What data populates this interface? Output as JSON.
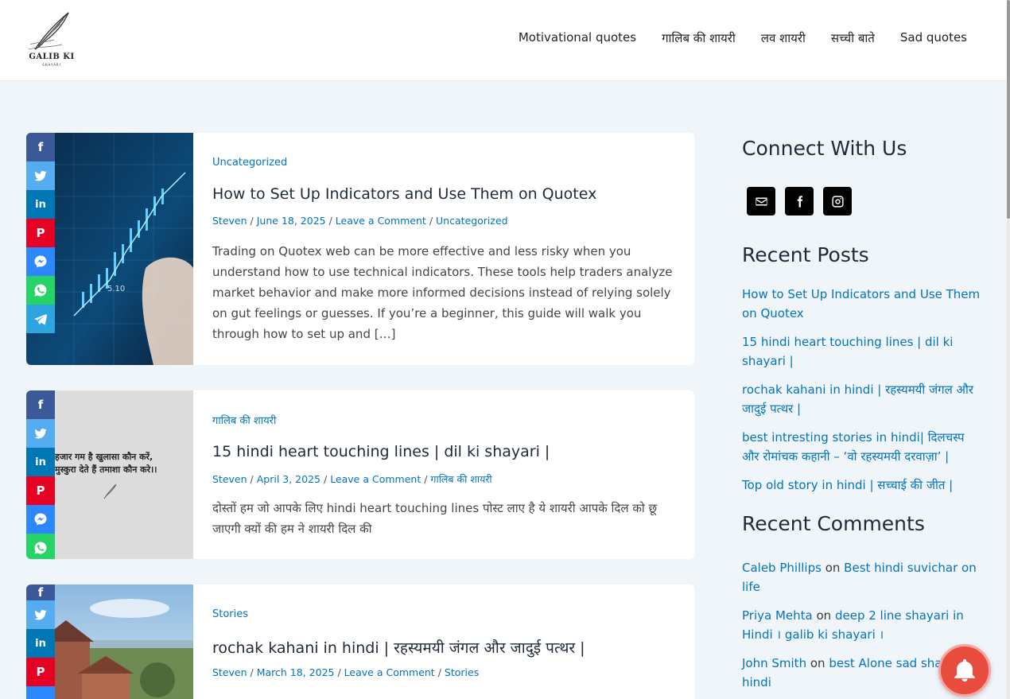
{
  "site": {
    "logo_text": "GALIB KI",
    "logo_sub": "SHAYARI"
  },
  "nav": [
    {
      "label": "Motivational quotes"
    },
    {
      "label": "गालिब की शायरी"
    },
    {
      "label": "लव शायरी"
    },
    {
      "label": "सच्ची बाते"
    },
    {
      "label": "Sad quotes"
    }
  ],
  "posts": [
    {
      "category": "Uncategorized",
      "title": "How to Set Up Indicators and Use Them on Quotex",
      "author": "Steven",
      "date": "June 18, 2025",
      "comment_link": "Leave a Comment",
      "meta_category": "Uncategorized",
      "excerpt": "Trading on Quotex web can be more effective and less risky when you understand how to use technical indicators. These tools help traders analyze market behavior and make more informed decisions instead of relying solely on gut feelings or guesses. If you’re a beginner, this guide will walk you through how to set up and […]",
      "thumb_text": "5.10"
    },
    {
      "category": "गालिब की शायरी",
      "title": "15 hindi heart touching lines | dil ki shayari |",
      "author": "Steven",
      "date": "April 3, 2025",
      "comment_link": "Leave a Comment",
      "meta_category": "गालिब की शायरी",
      "excerpt": "दोस्तों हम जो आपके लिए hindi heart touching lines पोस्ट लाए है ये शायरी आपके दिल को छू जाएगी क्यों की हम ने शायरी दिल की",
      "thumb_line1": "हजार गम है खुलासा कौन करें,",
      "thumb_line2": "मुस्कुरा देते हैं तमाशा कौन करे।।"
    },
    {
      "category": "Stories",
      "title": "rochak kahani in hindi | रहस्यमयी जंगल और जादुई पत्थर |",
      "author": "Steven",
      "date": "March 18, 2025",
      "comment_link": "Leave a Comment",
      "meta_category": "Stories"
    }
  ],
  "sidebar": {
    "connect_title": "Connect With Us",
    "recent_posts_title": "Recent Posts",
    "recent_posts": [
      "How to Set Up Indicators and Use Them on Quotex",
      "15 hindi heart touching lines | dil ki shayari |",
      "rochak kahani in hindi | रहस्यमयी जंगल और जादुई पत्थर |",
      "best intresting stories in hindi| दिलचस्प और रोमांचक कहानी – ‘वो रहस्यमयी दरवाज़ा’ |",
      "Top old story in hindi | सच्चाई की जीत |"
    ],
    "recent_comments_title": "Recent Comments",
    "comments": [
      {
        "author": "Caleb Phillips",
        "on": "on",
        "post": "Best hindi suvichar on life"
      },
      {
        "author": "Priya Mehta",
        "on": "on",
        "post": "deep 2 line shayari in Hindi । galib ki shayari ।"
      },
      {
        "author": "John Smith",
        "on": "on",
        "post": "best Alone sad shayari hindi"
      }
    ]
  },
  "meta_sep": "/",
  "colors": {
    "link": "#0274be",
    "bell": "#e74c3c"
  }
}
